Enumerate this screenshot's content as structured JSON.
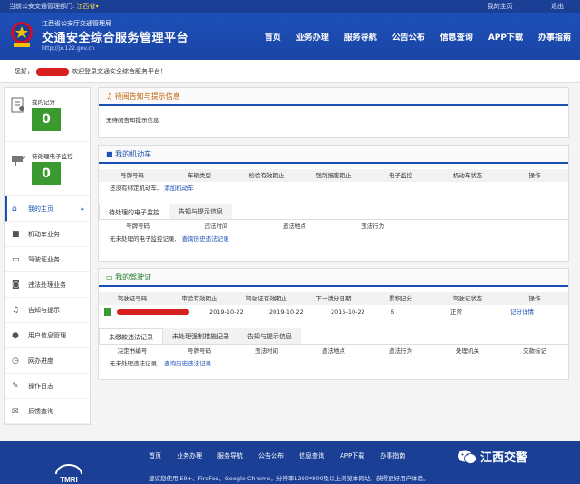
{
  "topbar": {
    "location_label": "当前公安交通管理部门:",
    "province": "江西省",
    "my_home": "我的主页",
    "logout": "退出"
  },
  "header": {
    "subtitle": "江西省公安厅交通管理局",
    "title": "交通安全综合服务管理平台",
    "url": "http://jx.122.gov.cn",
    "nav": [
      "首页",
      "业务办理",
      "服务导航",
      "公告公布",
      "信息查询",
      "APP下载",
      "办事指南"
    ]
  },
  "greeting": {
    "hello": "您好，",
    "welcome": "欢迎登录交通安全综合服务平台！"
  },
  "sidebar": {
    "score_label": "我的记分",
    "score_value": "0",
    "monitor_label": "待处理电子监控",
    "monitor_value": "0",
    "items": [
      {
        "label": "我的主页",
        "icon": "home-icon",
        "active": true
      },
      {
        "label": "机动车业务",
        "icon": "truck-icon"
      },
      {
        "label": "驾驶证业务",
        "icon": "id-card-icon"
      },
      {
        "label": "违法处理业务",
        "icon": "camera-icon"
      },
      {
        "label": "告知与提示",
        "icon": "bell-icon"
      },
      {
        "label": "用户信息管理",
        "icon": "user-icon"
      },
      {
        "label": "网办进度",
        "icon": "progress-icon"
      },
      {
        "label": "操作日志",
        "icon": "log-icon"
      },
      {
        "label": "反馈查询",
        "icon": "feedback-icon"
      }
    ]
  },
  "notice": {
    "title": "待阅告知与提示信息",
    "empty": "无待阅告知提示信息"
  },
  "vehicle": {
    "title": "我的机动车",
    "columns": [
      "号牌号码",
      "车辆类型",
      "检验有效期止",
      "强制报废期止",
      "电子监控",
      "机动车状态",
      "操作"
    ],
    "empty": "还没有绑定机动车,",
    "add_link": "添加机动车"
  },
  "vehicle_tabs": {
    "tabs": [
      "待处理的电子监控",
      "告知与提示信息"
    ],
    "columns": [
      "号牌号码",
      "违法时间",
      "违法地点",
      "违法行为"
    ],
    "empty": "无未处理的电子监控记录,",
    "history_link": "查询历史违法记录"
  },
  "license": {
    "title": "我的驾驶证",
    "columns": [
      "驾驶证号码",
      "审验有效期止",
      "驾驶证有效期止",
      "下一清分日期",
      "累积记分",
      "驾驶证状态",
      "操作"
    ],
    "row": {
      "audit_date": "2019-10-22",
      "valid_date": "2019-10-22",
      "clear_date": "2015-10-22",
      "score": "6",
      "status": "正常",
      "action": "记分详情"
    }
  },
  "license_tabs": {
    "tabs": [
      "未缴款违法记录",
      "未处理强制措施记录",
      "告知与提示信息"
    ],
    "columns": [
      "决定书编号",
      "号牌号码",
      "违法时间",
      "违法地点",
      "违法行为",
      "处理机关",
      "交款标记"
    ],
    "empty": "无未处理违法记录,",
    "history_link": "查询历史违法记录"
  },
  "footer": {
    "nav": [
      "首页",
      "业务办理",
      "服务导航",
      "公告公布",
      "信息查询",
      "APP下载",
      "办事指南"
    ],
    "note": "建议您使用IE9+、FireFox、Google Chrome，分辨率1280*800及以上浏览本网站，获得更好用户体验。",
    "wechat": "江西交警",
    "logo_text": "TMRI"
  }
}
